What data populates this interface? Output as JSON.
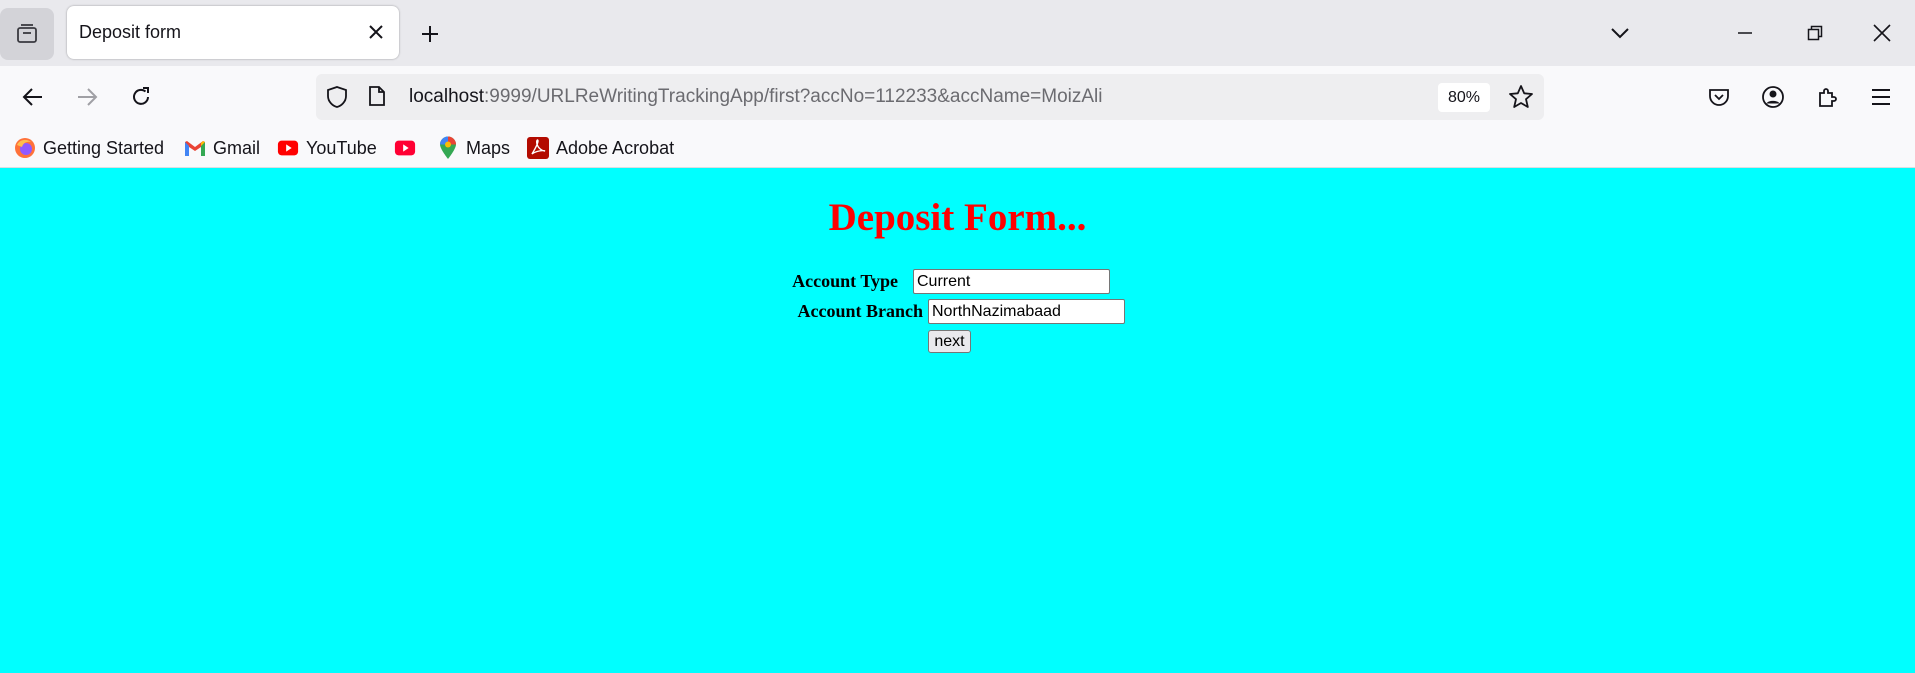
{
  "browser": {
    "tab": {
      "title": "Deposit form"
    },
    "url": {
      "host": "localhost",
      "rest": ":9999/URLReWritingTrackingApp/first?accNo=112233&accName=MoizAli"
    },
    "zoom": "80%",
    "bookmarks": [
      {
        "label": "Getting Started",
        "icon": "firefox-icon"
      },
      {
        "label": "Gmail",
        "icon": "gmail-icon"
      },
      {
        "label": "YouTube",
        "icon": "youtube-icon"
      },
      {
        "label": "",
        "icon": "youtube-icon"
      },
      {
        "label": "Maps",
        "icon": "maps-icon"
      },
      {
        "label": "Adobe Acrobat",
        "icon": "acrobat-icon"
      }
    ]
  },
  "form": {
    "title": "Deposit Form...",
    "account_type": {
      "label": "Account Type",
      "value": "Current"
    },
    "account_branch": {
      "label": "Account Branch",
      "value": "NorthNazimabaad"
    },
    "next_label": "next"
  },
  "colors": {
    "page_bg": "#00ffff",
    "title": "#ff0000"
  }
}
